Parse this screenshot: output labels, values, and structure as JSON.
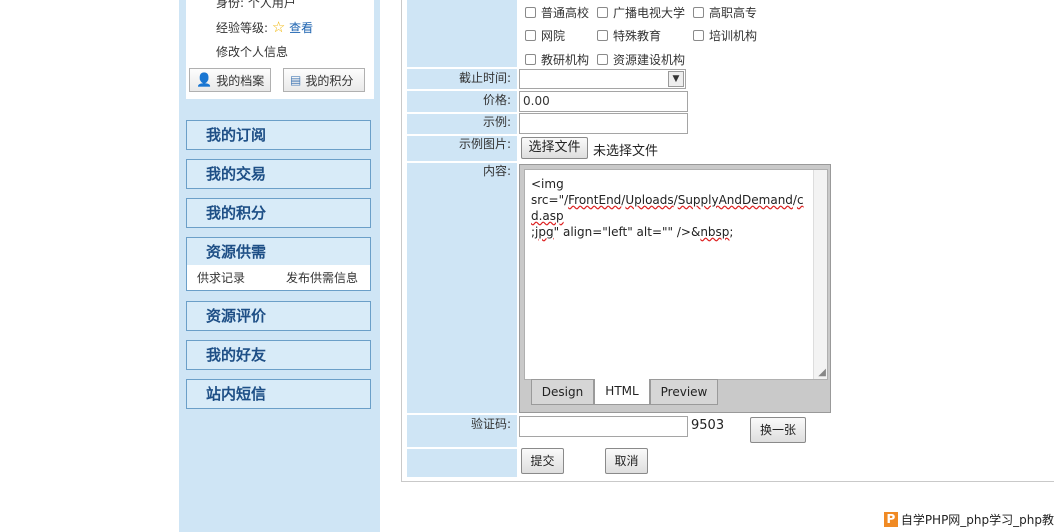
{
  "profile": {
    "identity_label": "身份:",
    "identity_value": "个人用户",
    "level_label": "经验等级:",
    "level_link": "查看",
    "edit_info": "修改个人信息",
    "btn_archive": "我的档案",
    "btn_points": "我的积分"
  },
  "menu": {
    "subscriptions": "我的订阅",
    "trades": "我的交易",
    "points": "我的积分",
    "supply_demand": "资源供需",
    "supply_records": "供求记录",
    "publish_supply": "发布供需信息",
    "reviews": "资源评价",
    "friends": "我的好友",
    "messages": "站内短信"
  },
  "form": {
    "targets": [
      "普通高校",
      "广播电视大学",
      "高职高专",
      "网院",
      "特殊教育",
      "培训机构",
      "教研机构",
      "资源建设机构"
    ],
    "deadline_label": "截止时间:",
    "deadline_value": "",
    "price_label": "价格:",
    "price_value": "0.00",
    "example_label": "示例:",
    "example_value": "",
    "example_image_label": "示例图片:",
    "choose_file": "选择文件",
    "no_file": "未选择文件",
    "content_label": "内容:",
    "captcha_label": "验证码:",
    "captcha_code": "9503",
    "refresh_captcha": "换一张",
    "submit": "提交",
    "cancel": "取消"
  },
  "editor": {
    "line1": "<img",
    "line2a": "src=\"/",
    "line2b": "FrontEnd",
    "line2c": "/",
    "line2d": "Uploads",
    "line2e": "/",
    "line2f": "SupplyAndDemand",
    "line2g": "/",
    "line2h": "cd.asp",
    "line3a": ";",
    "line3b": "jpg",
    "line3c": "\" align=\"left\" alt=\"\" />&",
    "line3d": "nbsp",
    "line3e": ";",
    "tabs": [
      "Design",
      "HTML",
      "Preview"
    ],
    "active_tab": "HTML"
  },
  "footer": {
    "logo_letter": "P",
    "text": "自学PHP网_php学习_php教"
  },
  "colors": {
    "sidebar_bg": "#cfe5f5",
    "menu_text": "#1e4f86",
    "menu_border": "#6b9fc8",
    "link": "#1d63b0"
  }
}
